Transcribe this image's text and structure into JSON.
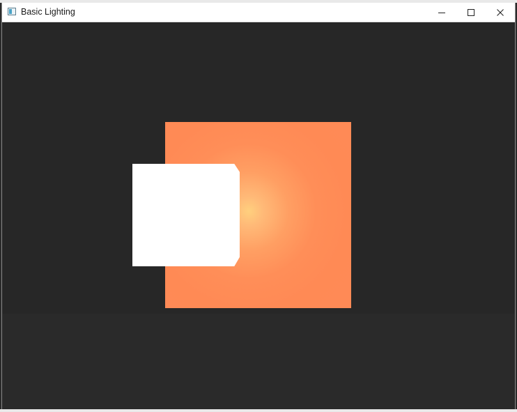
{
  "window": {
    "title": "Basic Lighting",
    "icon": "app-window-icon",
    "controls": {
      "minimize_icon": "minimize-icon",
      "maximize_icon": "maximize-icon",
      "close_icon": "close-icon"
    }
  },
  "scene": {
    "background_color": "#272727",
    "lit_object_color": "#ff8a55",
    "highlight_color": "#ffd07e",
    "lamp_color": "#ffffff"
  }
}
